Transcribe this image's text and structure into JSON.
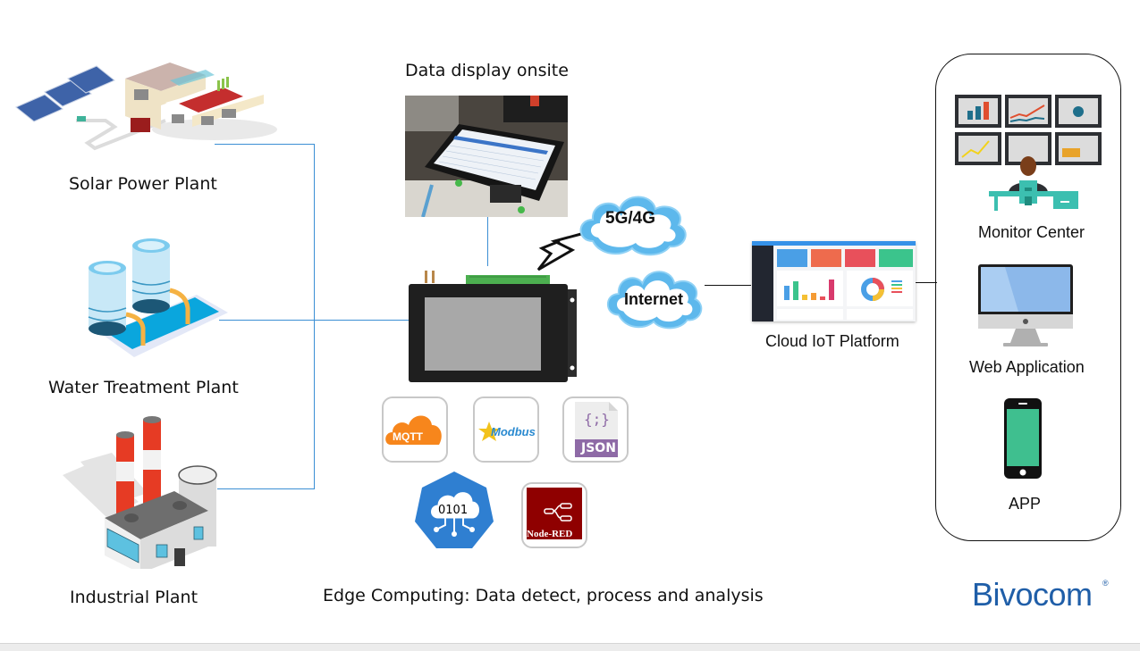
{
  "sources": [
    {
      "id": "solar",
      "label": "Solar Power Plant",
      "icon": "solar-plant-icon"
    },
    {
      "id": "water",
      "label": "Water Treatment Plant",
      "icon": "water-plant-icon"
    },
    {
      "id": "industrial",
      "label": "Industrial Plant",
      "icon": "factory-icon"
    }
  ],
  "onsite": {
    "label": "Data display onsite",
    "icon": "touchscreen-photo"
  },
  "gateway": {
    "icon": "edge-gateway-device"
  },
  "network": {
    "cellular": {
      "label": "5G/4G",
      "icon": "cloud-icon"
    },
    "internet": {
      "label": "Internet",
      "icon": "cloud-icon"
    }
  },
  "protocols": [
    {
      "id": "mqtt",
      "label": "MQTT",
      "color": "#f7861c"
    },
    {
      "id": "modbus",
      "label": "Modbus",
      "color": "#2a8ad0"
    },
    {
      "id": "json",
      "label": "JSON",
      "symbol": "{;}",
      "color": "#8e6aa6"
    },
    {
      "id": "binary",
      "label": "0101",
      "color": "#2f7fd1"
    },
    {
      "id": "nodered",
      "label": "Node-RED",
      "color": "#8f0000"
    }
  ],
  "edge_caption": "Edge Computing: Data detect, process and analysis",
  "cloud": {
    "label": "Cloud IoT Platform"
  },
  "clients": [
    {
      "id": "monitor",
      "label": "Monitor Center"
    },
    {
      "id": "web",
      "label": "Web Application"
    },
    {
      "id": "app",
      "label": "APP"
    }
  ],
  "brand": {
    "name": "Bivocom",
    "mark": "®",
    "color": "#1f5ea8"
  }
}
